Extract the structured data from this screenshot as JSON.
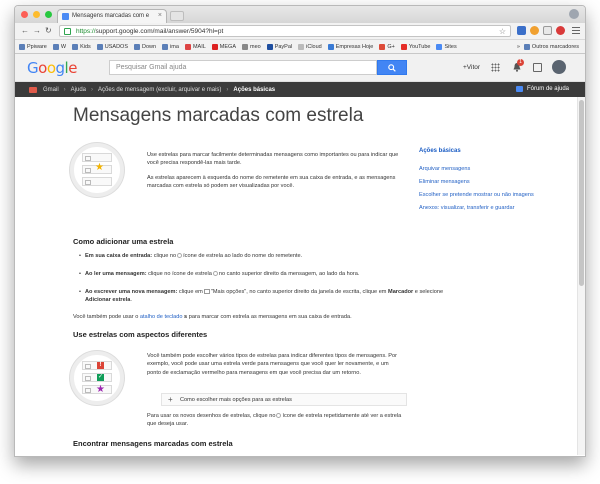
{
  "browser": {
    "tab_title": "Mensagens marcadas com e",
    "url_scheme": "https://",
    "url_rest": "support.google.com/mail/answer/5904?hl=pt"
  },
  "bookmarks": [
    "Ppiware",
    "W",
    "Kids",
    "USADOS",
    "Down",
    "ima",
    "MAIL",
    "MEGA",
    "meo",
    "PayPal",
    "iCloud",
    "Empresas Hoje",
    "G+",
    "YouTube",
    "Sites"
  ],
  "bookmarks_more": "»",
  "bookmarks_other": "Outros marcadores",
  "google": {
    "search_placeholder": "Pesquisar Gmail ajuda",
    "user_name": "+Vitor",
    "notif_count": "1"
  },
  "breadcrumb": {
    "items": [
      "Gmail",
      "Ajuda",
      "Ações de mensagem (excluir, arquivar e mais)"
    ],
    "current": "Ações básicas",
    "forum_label": "Fórum de ajuda"
  },
  "page": {
    "title": "Mensagens marcadas com estrela",
    "intro_p1": "Use estrelas para marcar facilmente determinadas mensagens como importantes ou para indicar que você precisa respondê-las mais tarde.",
    "intro_p2": "As estrelas aparecem à esquerda do nome do remetente em sua caixa de entrada, e as mensagens marcadas com estrela só podem ser visualizadas por você.",
    "section1_title": "Como adicionar uma estrela",
    "b1_strong": "Em sua caixa de entrada:",
    "b1_a": "clique no",
    "b1_b": "ícone de estrela ao lado do nome do remetente.",
    "b2_strong": "Ao ler uma mensagem:",
    "b2_a": "clique no ícone de estrela",
    "b2_b": "no canto superior direito da mensagem, ao lado da hora.",
    "b3_strong": "Ao escrever uma nova mensagem:",
    "b3_a": "clique em",
    "b3_b": "\"Mais opções\", no canto superior direito da janela de escrita, clique em",
    "b3_strong2": "Marcador",
    "b3_c": "e selecione",
    "b3_strong3": "Adicionar estrela",
    "b3_end": ".",
    "shortcut_a": "Você também pode usar o",
    "shortcut_link": "atalho de teclado",
    "shortcut_key": "s",
    "shortcut_b": "para marcar com estrela as mensagens em sua caixa de entrada.",
    "section2_title": "Use estrelas com aspectos diferentes",
    "p3": "Você também pode escolher vários tipos de estrelas para indicar diferentes tipos de mensagens. Por exemplo, você pode usar uma estrela verde para mensagens que você quer ler novamente, e um ponto de exclamação vermelho para mensagens em que você precisa dar um retorno.",
    "expander_label": "Como escolher mais opções para as estrelas",
    "p4_a": "Para usar os novos desenhos de estrelas, clique no",
    "p4_b": "ícone de estrela repetidamente até ver a estrela que deseja usar.",
    "section3_title": "Encontrar mensagens marcadas com estrela"
  },
  "sidebar": {
    "heading": "Ações básicas",
    "links": [
      "Arquivar mensagens",
      "Eliminar mensagens",
      "Escolher se pretende mostrar ou não imagens",
      "Anexos: visualizar, transferir e guardar"
    ]
  },
  "colors": {
    "link": "#2462c5",
    "breadcrumb_bar": "#3b3b3b",
    "search_button": "#4285f4",
    "star_yellow": "#f4b400"
  }
}
